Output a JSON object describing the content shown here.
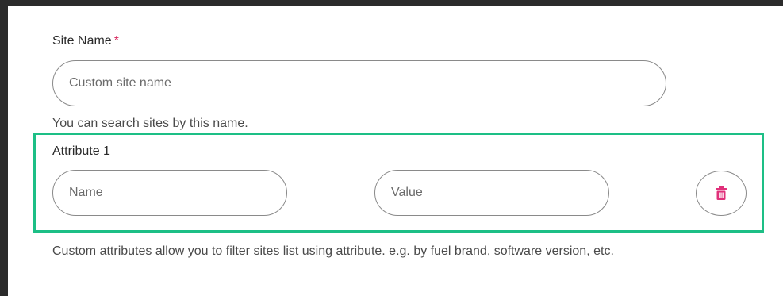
{
  "site_name": {
    "label": "Site Name",
    "required_mark": "*",
    "placeholder": "Custom site name",
    "value": "",
    "helper": "You can search sites by this name."
  },
  "attribute": {
    "label": "Attribute 1",
    "name_placeholder": "Name",
    "name_value": "",
    "value_placeholder": "Value",
    "value_value": "",
    "delete_icon": "trash-icon",
    "helper": "Custom attributes allow you to filter sites list using attribute. e.g. by fuel brand, software version, etc."
  },
  "colors": {
    "required": "#d6225a",
    "delete_icon": "#e0307a",
    "highlight_border": "#1dbf86",
    "frame": "#2b2b2b"
  }
}
